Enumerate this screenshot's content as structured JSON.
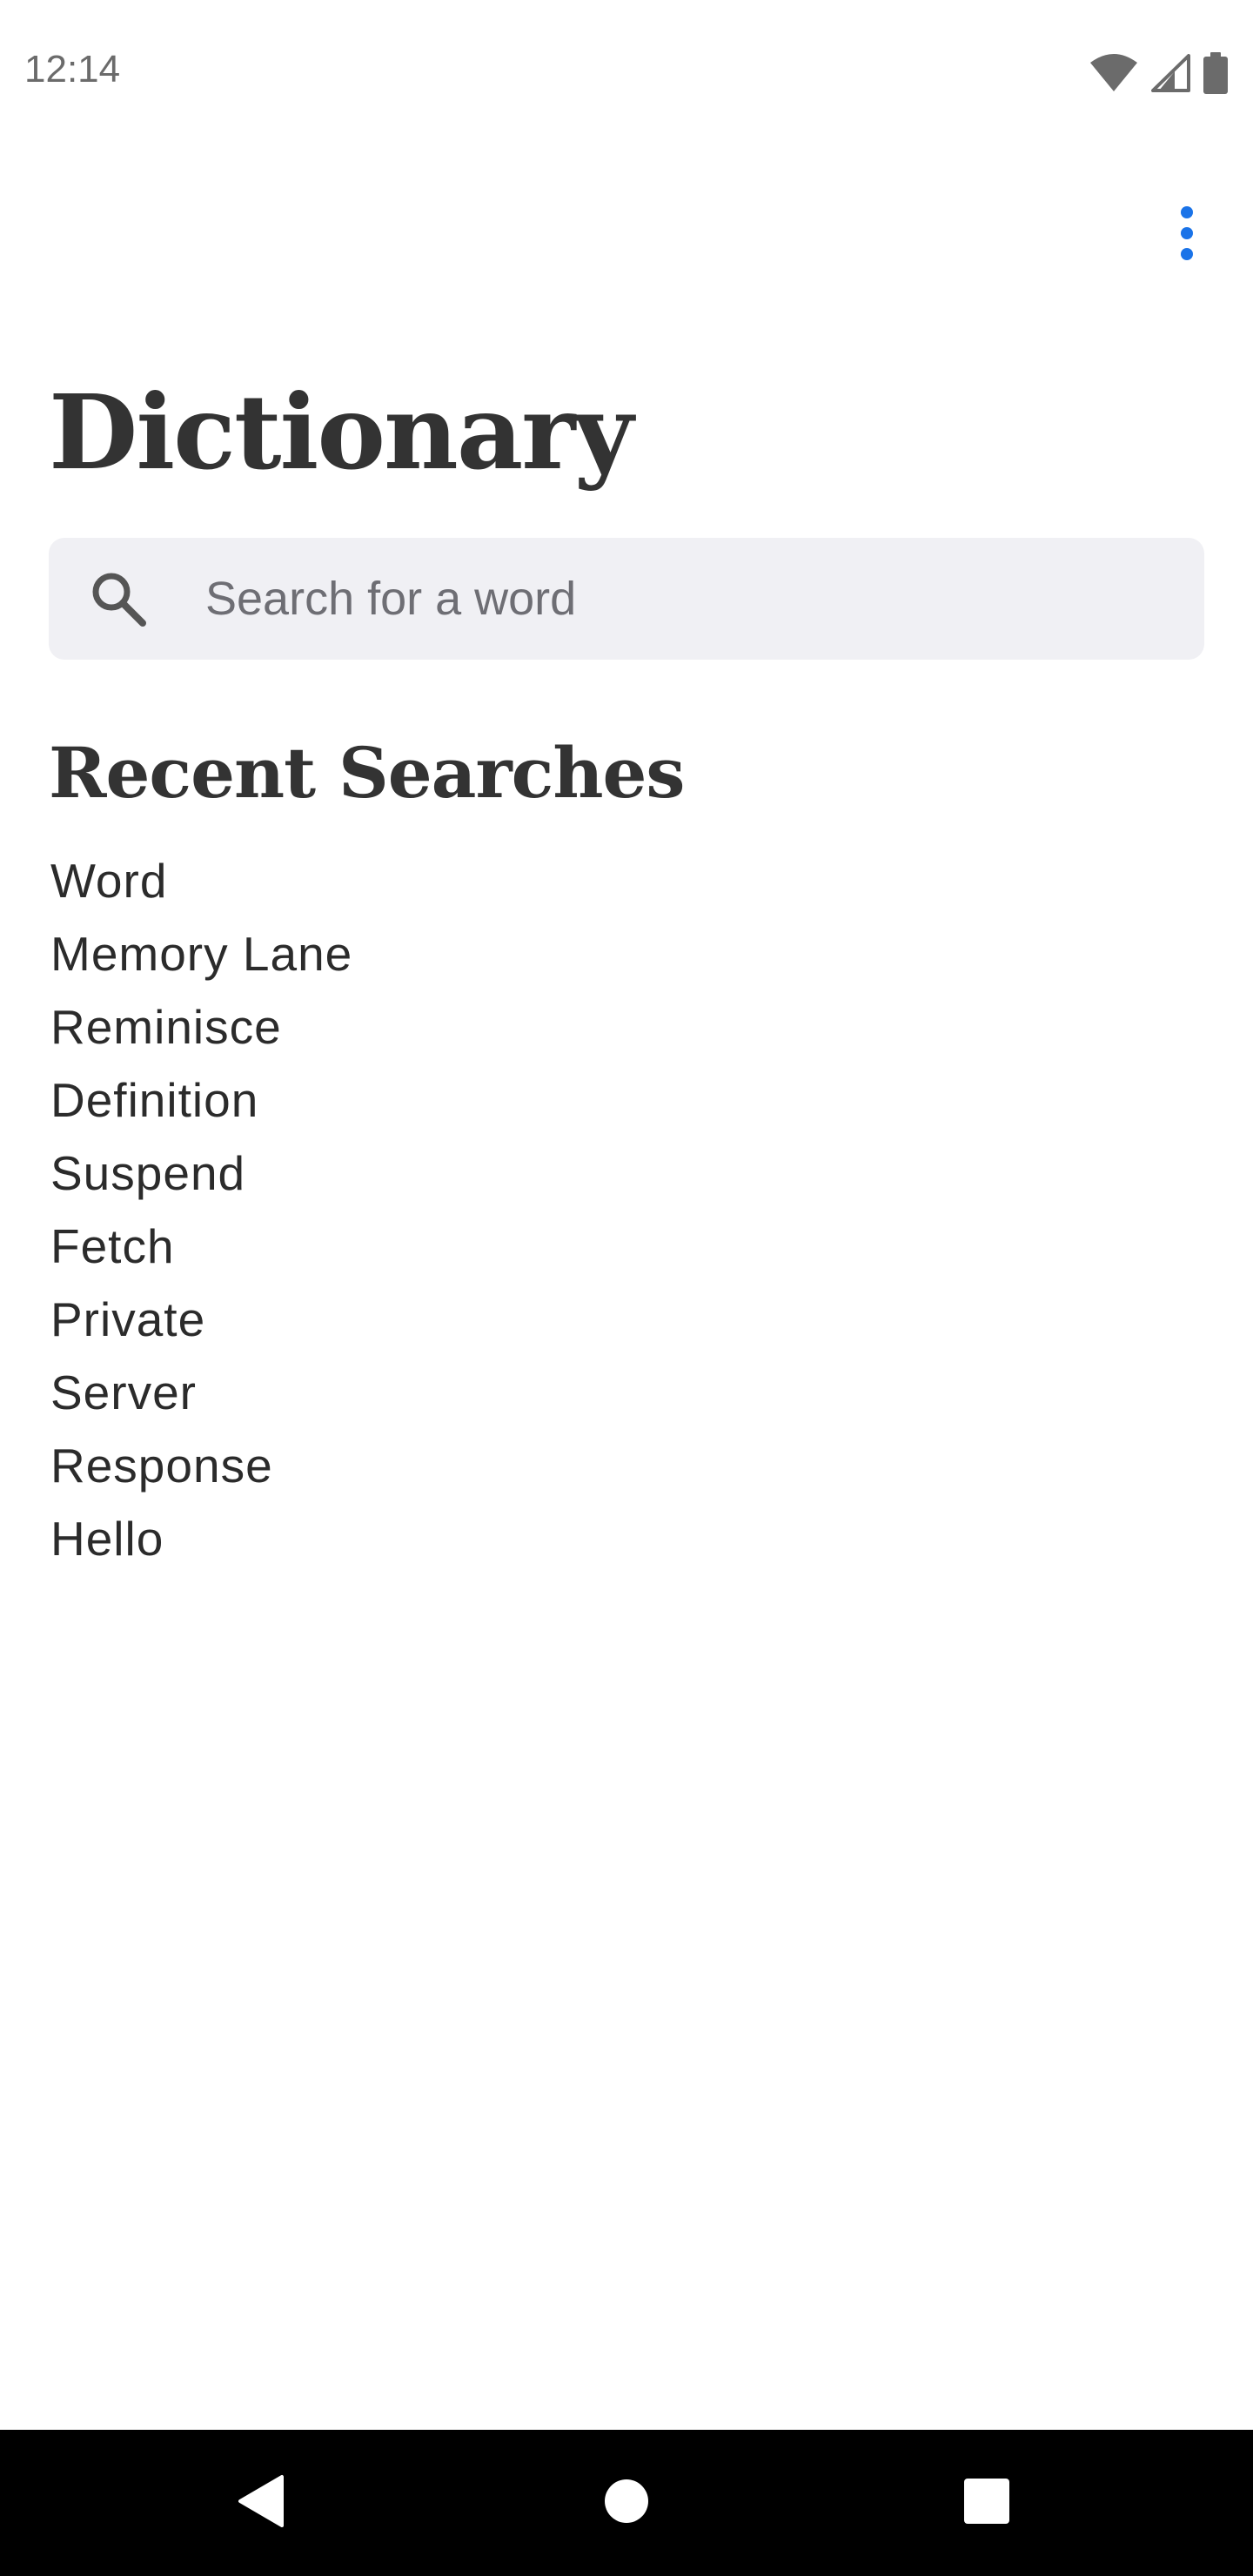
{
  "status_bar": {
    "time": "12:14",
    "icons": [
      "wifi-icon",
      "cellular-signal-icon",
      "battery-icon"
    ]
  },
  "header": {
    "overflow_icon": "more-vert-icon"
  },
  "title": "Dictionary",
  "search": {
    "icon": "search-icon",
    "placeholder": "Search for a word",
    "value": ""
  },
  "recent": {
    "heading": "Recent Searches",
    "items": [
      "Word",
      "Memory Lane",
      "Reminisce",
      "Definition",
      "Suspend",
      "Fetch",
      "Private",
      "Server",
      "Response",
      "Hello"
    ]
  },
  "nav_bar": {
    "buttons": [
      "back-icon",
      "home-icon",
      "recents-icon"
    ]
  },
  "colors": {
    "accent": "#1a73e8",
    "text": "#333333",
    "search_bg": "#f0f0f4",
    "nav_bg": "#000000"
  }
}
